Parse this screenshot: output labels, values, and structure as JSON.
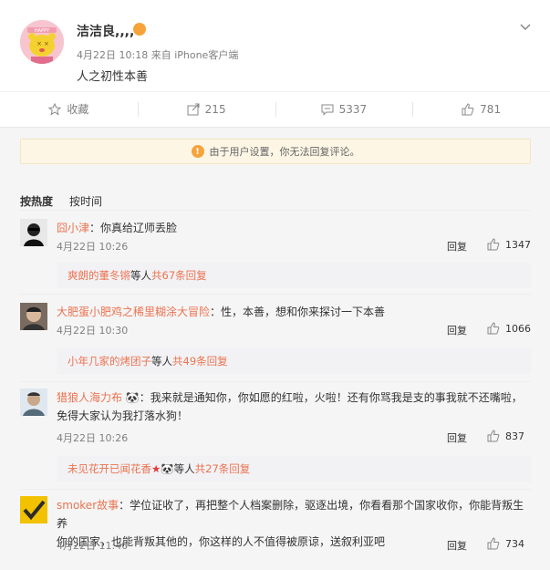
{
  "post": {
    "username": "洁洁良,,,,",
    "time": "4月22日 10:18",
    "source": "来自 iPhone客户端",
    "text": "人之初性本善",
    "avatar_text": "HAPPY",
    "actions": {
      "collect": "收藏",
      "repost": "215",
      "comment": "5337",
      "like": "781"
    }
  },
  "notice": {
    "text": "由于用户设置，你无法回复评论。",
    "icon": "!"
  },
  "tabs": {
    "hot": "按热度",
    "time": "按时间"
  },
  "comments": [
    {
      "user": "囧小津",
      "text": "：你真给辽师丢脸",
      "time": "4月22日 10:26",
      "reply": "回复",
      "likes": "1347",
      "sub_user": "爽朗的董冬锵",
      "sub_mid": " 等人 ",
      "sub_count": "共67条回复"
    },
    {
      "user": "大肥蛋小肥鸡之稀里糊涂大冒险",
      "text": "：性，本善，想和你来探讨一下本善",
      "time": "4月22日 10:30",
      "reply": "回复",
      "likes": "1066",
      "sub_user": "小年几家的烤团子",
      "sub_mid": " 等人 ",
      "sub_count": "共49条回复"
    },
    {
      "user": "猎狼人海力布",
      "text_line1": "：我来就是通知你，你如愿的红啦，火啦！还有你骂我是支的事我就不还嘴啦，",
      "text_line2": "免得大家认为我打落水狗！",
      "time": "4月22日 10:26",
      "reply": "回复",
      "likes": "837",
      "sub_user": "未见花开已闻花香",
      "sub_mid": " 等人 ",
      "sub_count": "共27条回复"
    },
    {
      "user": "smoker故事",
      "text_line1": "：学位证收了，再把整个人档案删除，驱逐出境，你看看那个国家收你，你能背叛生养",
      "text_line2": "你的国家，也能背叛其他的，你这样的人不值得被原谅，送叙利亚吧",
      "time": "4月22日 11:40",
      "reply": "回复",
      "likes": "734"
    }
  ],
  "colors": {
    "username_link": "#eb7350",
    "notice_bg": "#fdf6e5",
    "warn": "#f6a33b"
  }
}
